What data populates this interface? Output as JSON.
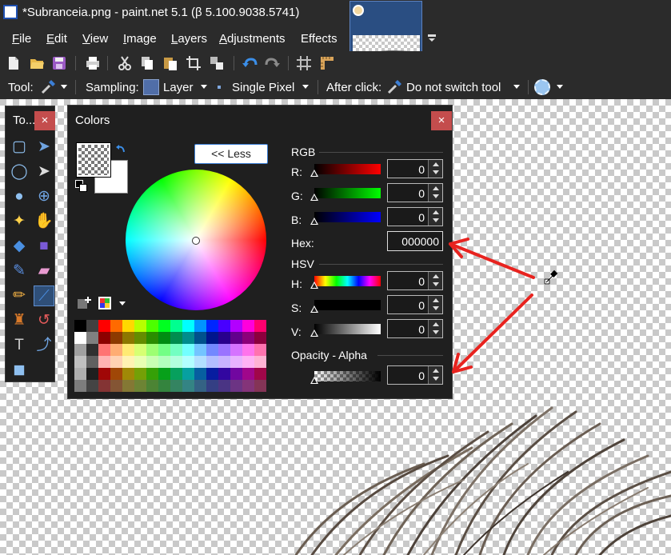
{
  "window": {
    "title": "*Subranceia.png - paint.net 5.1 (β 5.100.9038.5741)"
  },
  "menu": [
    {
      "label": "File",
      "key": "F",
      "rest": "ile"
    },
    {
      "label": "Edit",
      "key": "E",
      "rest": "dit"
    },
    {
      "label": "View",
      "key": "V",
      "rest": "iew"
    },
    {
      "label": "Image",
      "key": "I",
      "rest": "mage"
    },
    {
      "label": "Layers",
      "key": "L",
      "rest": "ayers"
    },
    {
      "label": "Adjustments",
      "key": "A",
      "rest": "djustments"
    },
    {
      "label": "Effects",
      "key": "",
      "rest": "Effects"
    }
  ],
  "toolbar": {
    "icons": [
      "new-file-icon",
      "open-file-icon",
      "save-file-icon",
      "print-icon",
      "cut-icon",
      "copy-icon",
      "paste-icon",
      "crop-icon",
      "paste-into-new-icon",
      "undo-icon",
      "redo-icon",
      "grid-icon",
      "ruler-icon"
    ]
  },
  "tool_options": {
    "tool_label": "Tool:",
    "sampling_label": "Sampling:",
    "sampling_layer": "Layer",
    "sampling_mode": "Single Pixel",
    "after_click_label": "After click:",
    "after_click_value": "Do not switch tool"
  },
  "tools_window": {
    "title": "To...",
    "close": "×",
    "tools": [
      "rectangle-select",
      "move-selection",
      "lasso-select",
      "move-selected",
      "ellipse-select",
      "zoom",
      "magic-wand",
      "pan",
      "paint-bucket",
      "gradient",
      "paintbrush",
      "eraser",
      "pencil",
      "color-picker",
      "clone-stamp",
      "recolor",
      "text",
      "line-curve",
      "shapes"
    ]
  },
  "colors_window": {
    "title": "Colors",
    "close": "×",
    "less_button": "<< Less",
    "rgb_label": "RGB",
    "hsv_label": "HSV",
    "opacity_label": "Opacity - Alpha",
    "hex_label": "Hex:",
    "hex_value": "000000",
    "fields": [
      {
        "label": "R:",
        "value": "0"
      },
      {
        "label": "G:",
        "value": "0"
      },
      {
        "label": "B:",
        "value": "0"
      },
      {
        "label": "H:",
        "value": "0"
      },
      {
        "label": "S:",
        "value": "0"
      },
      {
        "label": "V:",
        "value": "0"
      }
    ],
    "alpha_value": "0",
    "colors": {
      "accent": "#c44d4d",
      "window_bg": "#1f1f1f",
      "titlebar_bg": "#2b2b2b",
      "annotation_arrow": "#e8231f"
    }
  }
}
